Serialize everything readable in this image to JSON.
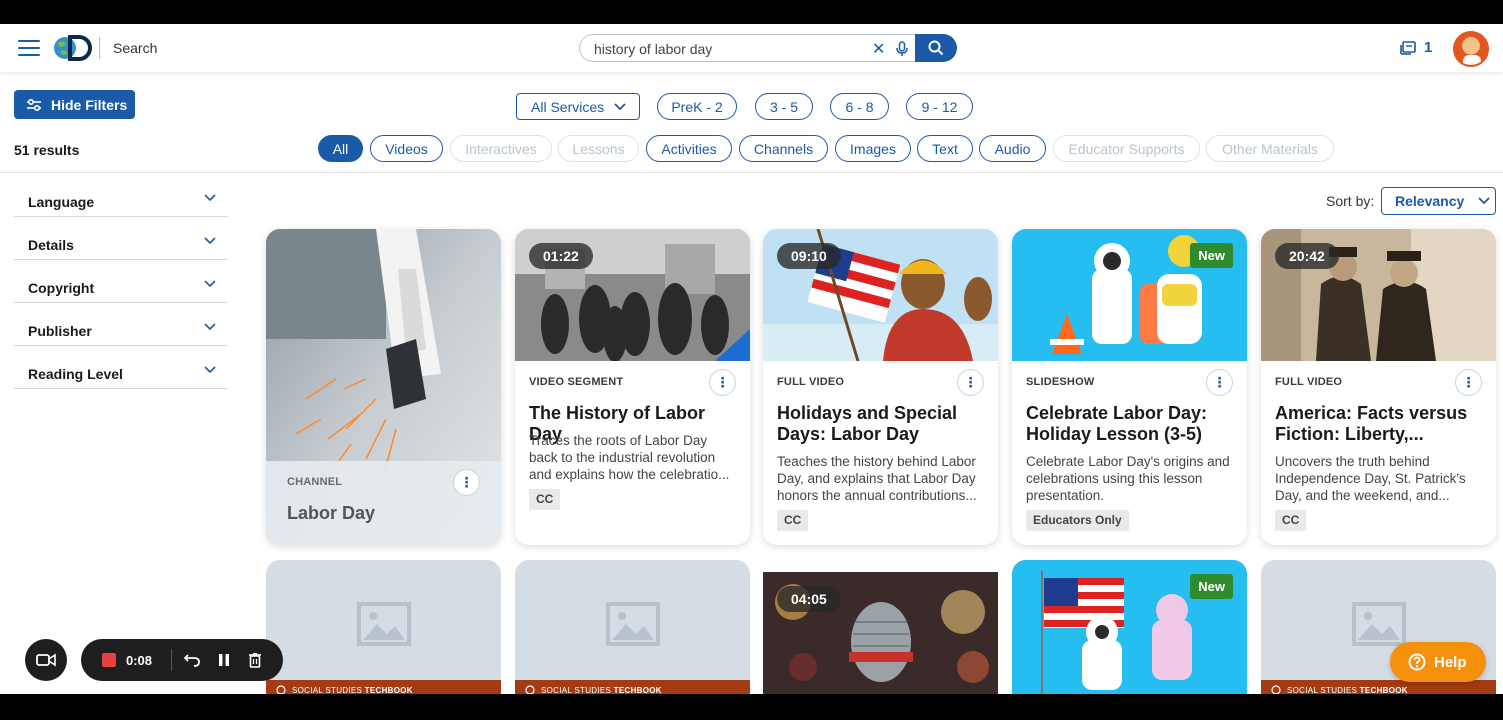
{
  "header": {
    "search_label": "Search",
    "query": "history of labor day",
    "notifications_count": "1",
    "brand_color": "#1b5aa6"
  },
  "filters": {
    "hide_filters_label": "Hide Filters",
    "results_count": "51 results",
    "services_label": "All Services",
    "grades": [
      "PreK - 2",
      "3 - 5",
      "6 - 8",
      "9 - 12"
    ],
    "types": [
      {
        "label": "All",
        "state": "active"
      },
      {
        "label": "Videos",
        "state": "enabled"
      },
      {
        "label": "Interactives",
        "state": "disabled"
      },
      {
        "label": "Lessons",
        "state": "disabled"
      },
      {
        "label": "Activities",
        "state": "enabled"
      },
      {
        "label": "Channels",
        "state": "enabled"
      },
      {
        "label": "Images",
        "state": "enabled"
      },
      {
        "label": "Text",
        "state": "enabled"
      },
      {
        "label": "Audio",
        "state": "enabled"
      },
      {
        "label": "Educator Supports",
        "state": "disabled"
      },
      {
        "label": "Other Materials",
        "state": "disabled"
      }
    ]
  },
  "sidebar": {
    "facets": [
      "Language",
      "Details",
      "Copyright",
      "Publisher",
      "Reading Level"
    ]
  },
  "sort": {
    "label": "Sort by:",
    "value": "Relevancy"
  },
  "cards": [
    {
      "type": "CHANNEL",
      "title": "Labor Day"
    },
    {
      "type": "VIDEO SEGMENT",
      "duration": "01:22",
      "title": "The History of Labor Day",
      "desc": "Traces the roots of Labor Day back to the industrial revolution and explains how the celebratio...",
      "tag": "CC"
    },
    {
      "type": "FULL VIDEO",
      "duration": "09:10",
      "title": "Holidays and Special Days: Labor Day",
      "desc": "Teaches the history behind Labor Day, and explains that Labor Day honors the annual contributions...",
      "tag": "CC"
    },
    {
      "type": "SLIDESHOW",
      "badge": "New",
      "title": "Celebrate Labor Day: Holiday Lesson (3-5)",
      "desc": "Celebrate Labor Day's origins and celebrations using this lesson presentation.",
      "tag": "Educators Only"
    },
    {
      "type": "FULL VIDEO",
      "duration": "20:42",
      "title": "America: Facts versus Fiction: Liberty,...",
      "desc": "Uncovers the truth behind Independence Day, St. Patrick's Day, and the weekend, and...",
      "tag": "CC"
    }
  ],
  "row2": {
    "ss_label_pre": "SOCIAL STUDIES ",
    "ss_label_bold": "TECHBOOK",
    "duration": "04:05",
    "badge": "New"
  },
  "recorder": {
    "time": "0:08"
  },
  "help_label": "Help"
}
